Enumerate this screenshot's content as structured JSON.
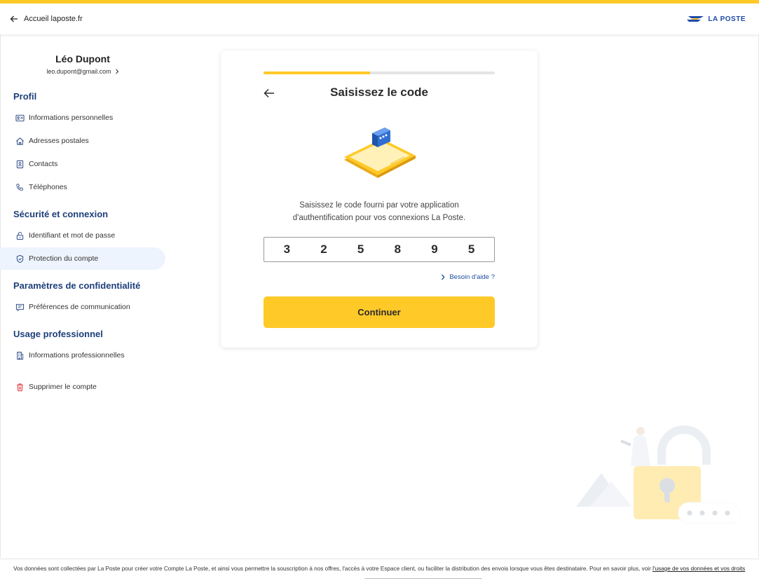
{
  "header": {
    "back_label": "Accueil laposte.fr",
    "logo_text": "LA POSTE"
  },
  "user": {
    "name": "Léo Dupont",
    "email": "leo.dupont@gmail.com"
  },
  "sidebar": {
    "sections": [
      {
        "title": "Profil",
        "items": [
          {
            "label": "Informations personnelles",
            "icon": "id-card-icon"
          },
          {
            "label": "Adresses postales",
            "icon": "home-icon"
          },
          {
            "label": "Contacts",
            "icon": "contact-book-icon"
          },
          {
            "label": "Téléphones",
            "icon": "phone-icon"
          }
        ]
      },
      {
        "title": "Sécurité et connexion",
        "items": [
          {
            "label": "Identifiant et mot de passe",
            "icon": "padlock-icon"
          },
          {
            "label": "Protection du compte",
            "icon": "shield-icon",
            "active": true
          }
        ]
      },
      {
        "title": "Paramètres de confidentialité",
        "items": [
          {
            "label": "Préférences de communication",
            "icon": "message-icon"
          }
        ]
      },
      {
        "title": "Usage professionnel",
        "items": [
          {
            "label": "Informations professionnelles",
            "icon": "building-icon"
          }
        ]
      }
    ],
    "delete_label": "Supprimer le compte"
  },
  "card": {
    "progress_percent": 46,
    "title": "Saisissez le code",
    "description": "Saisissez le code fourni par votre application d'authentification pour vos connexions La Poste.",
    "code_digits": [
      "3",
      "2",
      "5",
      "8",
      "9",
      "5"
    ],
    "help_label": "Besoin d'aide ?",
    "continue_label": "Continuer"
  },
  "footer": {
    "text": "Vos données sont collectées par La Poste pour créer votre Compte La Poste, et ainsi vous permettre la souscription à nos offres, l'accès à votre Espace client, ou faciliter la distribution des envois lorsque vous êtes destinataire. Pour en savoir plus, voir ",
    "link_label": "l'usage de vos données et vos droits"
  },
  "colors": {
    "accent_yellow": "#ffc928",
    "brand_blue": "#1d3f7a",
    "link_blue": "#1d4fa0",
    "active_bg": "#eef4fd",
    "danger_red": "#e0252b"
  }
}
